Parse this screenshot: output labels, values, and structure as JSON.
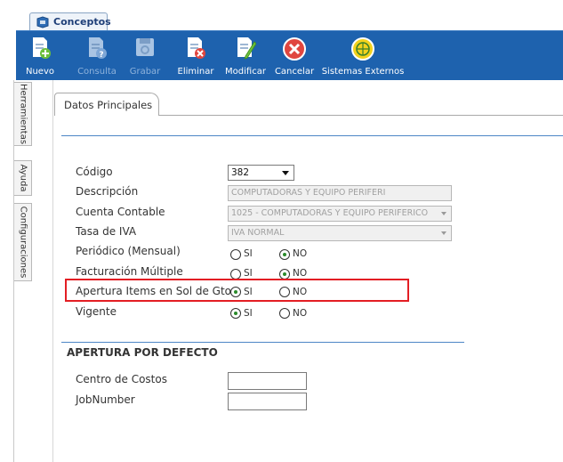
{
  "window_tab": {
    "label": "Conceptos"
  },
  "toolbar": {
    "buttons": [
      {
        "label": "Nuevo",
        "icon": "document-add-icon",
        "enabled": true
      },
      {
        "label": "Consulta",
        "icon": "document-help-icon",
        "enabled": false
      },
      {
        "label": "Grabar",
        "icon": "save-disk-icon",
        "enabled": false
      },
      {
        "label": "Eliminar",
        "icon": "document-delete-icon",
        "enabled": true
      },
      {
        "label": "Modificar",
        "icon": "document-edit-icon",
        "enabled": true
      },
      {
        "label": "Cancelar",
        "icon": "cancel-x-icon",
        "enabled": true
      },
      {
        "label": "Sistemas Externos",
        "icon": "external-systems-icon",
        "enabled": true
      }
    ]
  },
  "side_tabs": [
    "Herramientas",
    "Ayuda",
    "Configuraciones"
  ],
  "form": {
    "tab_label": "Datos Principales",
    "codigo": {
      "label": "Código",
      "value": "382"
    },
    "descripcion": {
      "label": "Descripción",
      "value": "COMPUTADORAS Y EQUIPO PERIFERI"
    },
    "cuenta_contable": {
      "label": "Cuenta Contable",
      "value": "1025 - COMPUTADORAS Y EQUIPO PERIFERICO"
    },
    "tasa_iva": {
      "label": "Tasa de IVA",
      "value": "IVA NORMAL"
    },
    "periodico": {
      "label": "Periódico (Mensual)",
      "options": [
        "SI",
        "NO"
      ],
      "selected": "NO"
    },
    "facturacion_multiple": {
      "label": "Facturación Múltiple",
      "options": [
        "SI",
        "NO"
      ],
      "selected": "NO"
    },
    "apertura_items": {
      "label": "Apertura Items en Sol de Gto",
      "options": [
        "SI",
        "NO"
      ],
      "selected": "SI"
    },
    "vigente": {
      "label": "Vigente",
      "options": [
        "SI",
        "NO"
      ],
      "selected": "SI"
    }
  },
  "apertura_defecto": {
    "title": "APERTURA POR DEFECTO",
    "centro_costos": {
      "label": "Centro de Costos",
      "value": ""
    },
    "job_number": {
      "label": "JobNumber",
      "value": ""
    }
  },
  "colors": {
    "toolbar_bg": "#1e62ae",
    "highlight": "#e31e24",
    "section_rule": "#4d86c6",
    "radio_dot": "#2a8a2a"
  }
}
